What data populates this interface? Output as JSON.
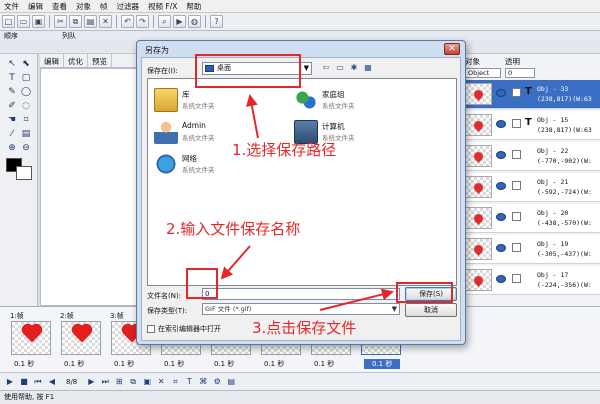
{
  "menubar": [
    "文件",
    "编辑",
    "查看",
    "对象",
    "帧",
    "过滤器",
    "视频 F/X",
    "帮助"
  ],
  "subhead": {
    "order": "顺序",
    "column": "列队"
  },
  "tabs": [
    "编辑",
    "优化",
    "预览"
  ],
  "objects_panel": {
    "object_label": "对象",
    "alpha_label": "透明",
    "object_select": "Object",
    "alpha_value": "0",
    "rows": [
      {
        "name": "Obj - 33",
        "coords": "(238,817)(W:63",
        "glyph": "T",
        "selected": true
      },
      {
        "name": "Obj - 15",
        "coords": "(238,817)(W:63",
        "glyph": "T",
        "selected": false
      },
      {
        "name": "Obj - 22",
        "coords": "(-770,-902)(W:",
        "glyph": "",
        "selected": false
      },
      {
        "name": "Obj - 21",
        "coords": "(-592,-724)(W:",
        "glyph": "",
        "selected": false
      },
      {
        "name": "Obj - 20",
        "coords": "(-438,-570)(W:",
        "glyph": "",
        "selected": false
      },
      {
        "name": "Obj - 19",
        "coords": "(-305,-437)(W:",
        "glyph": "",
        "selected": false
      },
      {
        "name": "Obj - 17",
        "coords": "(-224,-356)(W:",
        "glyph": "",
        "selected": false
      }
    ]
  },
  "frames": [
    {
      "label": "1:帧",
      "time": "0.1 秒"
    },
    {
      "label": "2:帧",
      "time": "0.1 秒"
    },
    {
      "label": "3:帧",
      "time": "0.1 秒"
    },
    {
      "label": "",
      "time": "0.1 秒"
    },
    {
      "label": "",
      "time": "0.1 秒"
    },
    {
      "label": "",
      "time": "0.1 秒"
    },
    {
      "label": "",
      "time": "0.1 秒"
    },
    {
      "label": "",
      "time": "0.1 秒"
    }
  ],
  "playbar": {
    "frame_info": "8/8"
  },
  "statusbar": {
    "text": "使用帮助, 按 F1"
  },
  "dialog": {
    "title": "另存为",
    "save_in_label": "保存在(I):",
    "save_in_value": "桌面",
    "items": [
      {
        "name": "库",
        "type": "系统文件夹",
        "icon": "library-icon"
      },
      {
        "name": "家庭组",
        "type": "系统文件夹",
        "icon": "homegroup-icon"
      },
      {
        "name": "Admin",
        "type": "系统文件夹",
        "icon": "user-folder-icon"
      },
      {
        "name": "计算机",
        "type": "系统文件夹",
        "icon": "computer-icon"
      },
      {
        "name": "网络",
        "type": "系统文件夹",
        "icon": "network-icon"
      }
    ],
    "file_name_label": "文件名(N):",
    "file_name_value": "0",
    "file_type_label": "保存类型(T):",
    "file_type_value": "GIF 文件 (*.gif)",
    "save_button": "保存(S)",
    "cancel_button": "取消",
    "open_in_editor": "在索引编辑器中打开"
  },
  "annotations": {
    "step1": "1.选择保存路径",
    "step2": "2.输入文件保存名称",
    "step3": "3.点击保存文件"
  },
  "colors": {
    "annotation": "#e6272a",
    "selection": "#3a6fc3"
  }
}
